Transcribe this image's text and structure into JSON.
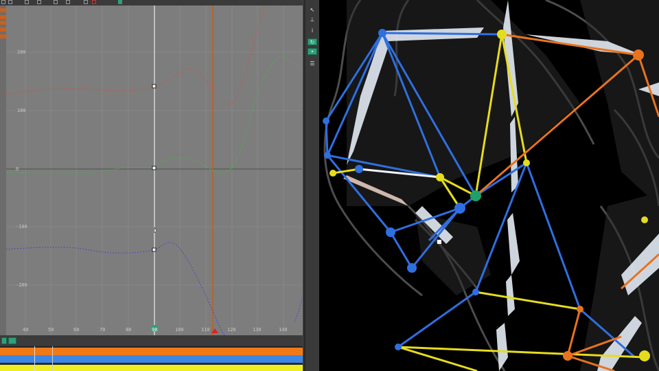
{
  "graph_editor": {
    "y_axis_labels": [
      "200",
      "100",
      "0",
      "-100",
      "-200"
    ],
    "x_axis_labels": [
      "40",
      "50",
      "60",
      "70",
      "80",
      "90",
      "100",
      "110",
      "120",
      "130",
      "140"
    ],
    "current_frame_label": "90",
    "curve_colors": {
      "x_channel": "#e0483c",
      "y_channel": "#3fbf3f",
      "z_channel": "#3a3adb"
    },
    "playhead_color": "#e8e8e8",
    "end_marker_color": "#c0601e"
  },
  "timeline": {
    "track_colors": [
      "#f07a16",
      "#3d86e6",
      "#eeee22"
    ]
  },
  "viewport": {
    "bone_colors": {
      "blue": "#2f6fe0",
      "yellow": "#e6dc1e",
      "orange": "#e8731e",
      "white": "#f2f2f2",
      "green": "#1fa06a"
    }
  }
}
